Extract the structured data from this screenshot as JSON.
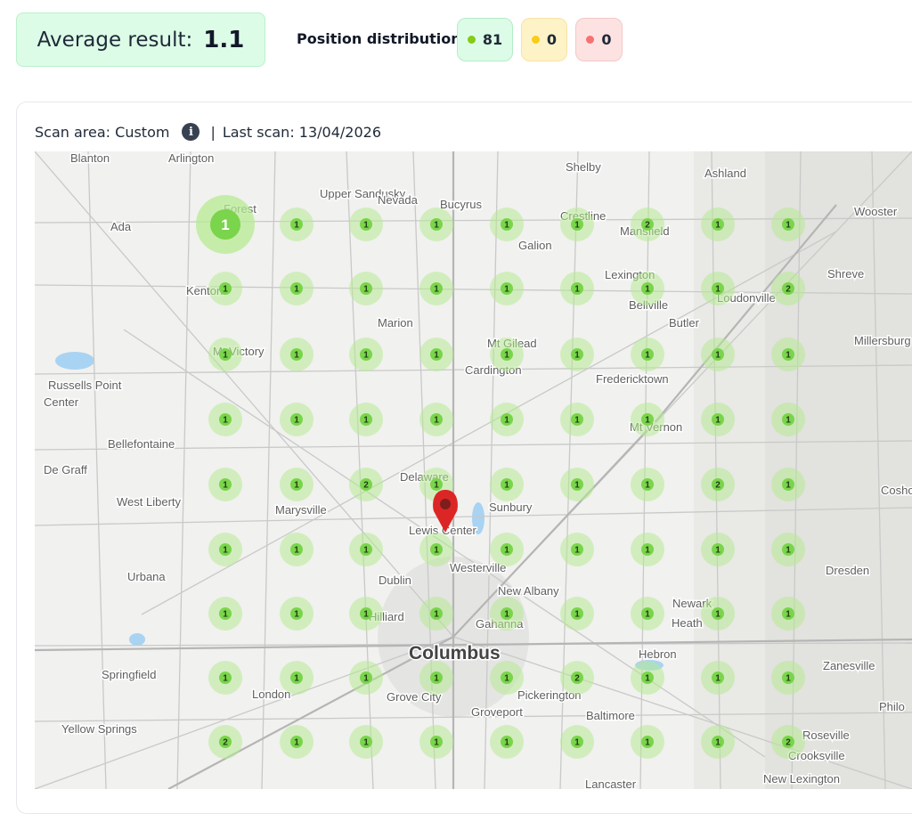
{
  "summary": {
    "average_label": "Average result:",
    "average_value": "1.1",
    "distribution_label": "Position distribution:",
    "green_count": "81",
    "yellow_count": "0",
    "red_count": "0"
  },
  "colors": {
    "green_dot": "#84cc16",
    "yellow_dot": "#facc15",
    "red_dot": "#f87171",
    "marker_fill": "#7ad44c",
    "marker_glow": "#b7ea93",
    "pin": "#dc2626"
  },
  "scan": {
    "area_label": "Scan area: Custom",
    "separator": "|",
    "last_scan_label": "Last scan: 13/04/2026"
  },
  "map": {
    "towns": [
      {
        "name": "Blanton"
      },
      {
        "name": "Arlington"
      },
      {
        "name": "Shelby"
      },
      {
        "name": "Ashland"
      },
      {
        "name": "Forest"
      },
      {
        "name": "Upper Sandusky"
      },
      {
        "name": "Nevada"
      },
      {
        "name": "Bucyrus"
      },
      {
        "name": "Crestline"
      },
      {
        "name": "Wooster"
      },
      {
        "name": "Ada"
      },
      {
        "name": "Galion"
      },
      {
        "name": "Mansfield"
      },
      {
        "name": "Lexington"
      },
      {
        "name": "Shreve"
      },
      {
        "name": "Kenton"
      },
      {
        "name": "Bellville"
      },
      {
        "name": "Loudonville"
      },
      {
        "name": "Marion"
      },
      {
        "name": "Butler"
      },
      {
        "name": "Mt Gilead"
      },
      {
        "name": "Millersburg"
      },
      {
        "name": "Mt Victory"
      },
      {
        "name": "Cardington"
      },
      {
        "name": "Fredericktown"
      },
      {
        "name": "Russells Point"
      },
      {
        "name": "Center"
      },
      {
        "name": "Mt Vernon"
      },
      {
        "name": "Bellefontaine"
      },
      {
        "name": "De Graff"
      },
      {
        "name": "Delaware"
      },
      {
        "name": "West Liberty"
      },
      {
        "name": "Sunbury"
      },
      {
        "name": "Coshocton"
      },
      {
        "name": "Marysville"
      },
      {
        "name": "Lewis Center"
      },
      {
        "name": "Westerville"
      },
      {
        "name": "Urbana"
      },
      {
        "name": "Dublin"
      },
      {
        "name": "Dresden"
      },
      {
        "name": "New Albany"
      },
      {
        "name": "Newark"
      },
      {
        "name": "Hilliard"
      },
      {
        "name": "Gahanna"
      },
      {
        "name": "Heath"
      },
      {
        "name": "Columbus"
      },
      {
        "name": "Hebron"
      },
      {
        "name": "Zanesville"
      },
      {
        "name": "Springfield"
      },
      {
        "name": "London"
      },
      {
        "name": "Grove City"
      },
      {
        "name": "Pickerington"
      },
      {
        "name": "Philo"
      },
      {
        "name": "Groveport"
      },
      {
        "name": "Baltimore"
      },
      {
        "name": "Yellow Springs"
      },
      {
        "name": "Roseville"
      },
      {
        "name": "Crooksville"
      },
      {
        "name": "New Lexington"
      },
      {
        "name": "Lancaster"
      }
    ],
    "grid_ranks": [
      [
        "1",
        "1",
        "1",
        "1",
        "1",
        "1",
        "2",
        "1",
        "1"
      ],
      [
        "1",
        "1",
        "1",
        "1",
        "1",
        "1",
        "1",
        "1",
        "2"
      ],
      [
        "1",
        "1",
        "1",
        "1",
        "1",
        "1",
        "1",
        "1",
        "1"
      ],
      [
        "1",
        "1",
        "1",
        "1",
        "1",
        "1",
        "1",
        "1",
        "1"
      ],
      [
        "1",
        "1",
        "2",
        "1",
        "1",
        "1",
        "1",
        "2",
        "1"
      ],
      [
        "1",
        "1",
        "1",
        "1",
        "1",
        "1",
        "1",
        "1",
        "1"
      ],
      [
        "1",
        "1",
        "1",
        "1",
        "1",
        "1",
        "1",
        "1",
        "1"
      ],
      [
        "1",
        "1",
        "1",
        "1",
        "1",
        "2",
        "1",
        "1",
        "1"
      ],
      [
        "2",
        "1",
        "1",
        "1",
        "1",
        "1",
        "1",
        "1",
        "2"
      ]
    ],
    "highlighted_rank": "1"
  }
}
